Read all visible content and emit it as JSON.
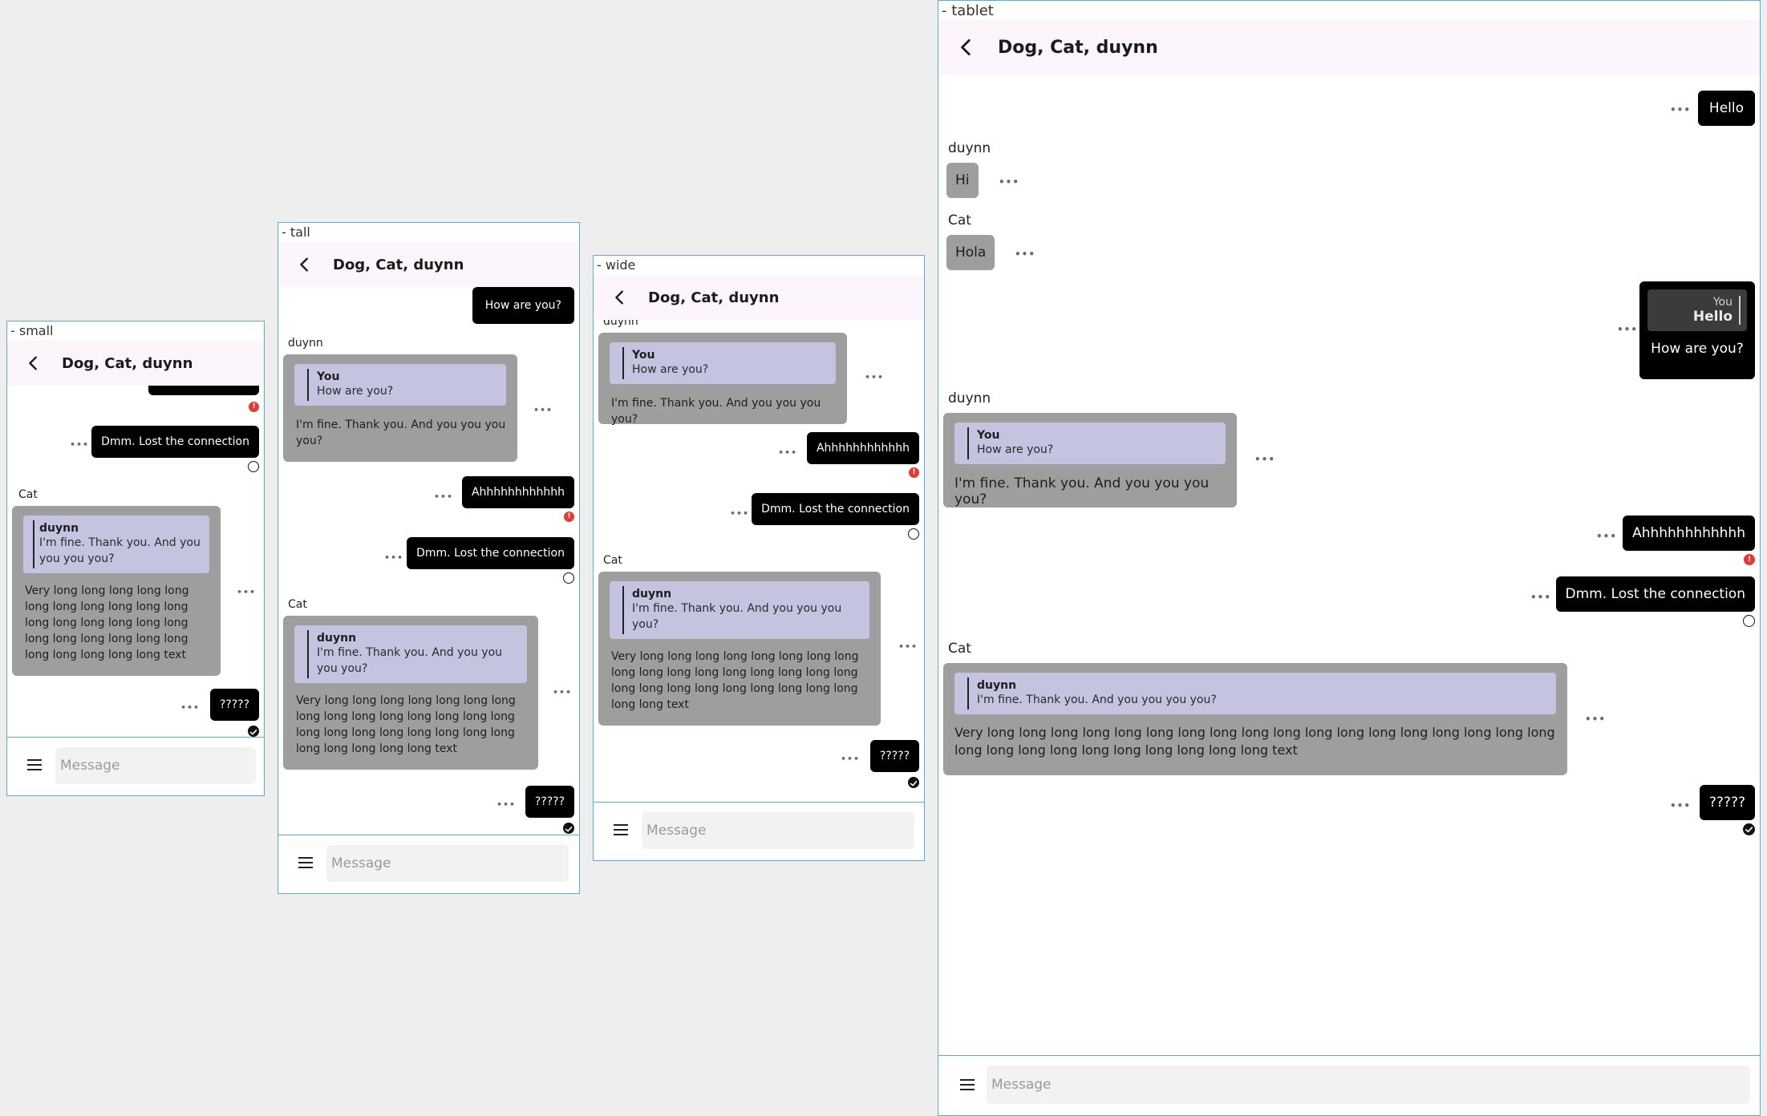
{
  "frames": {
    "small": "- small",
    "tall": "- tall",
    "wide": "- wide",
    "tablet": "- tablet"
  },
  "chat": {
    "title": "Dog, Cat, duynn",
    "input_placeholder": "Message",
    "more": "•••"
  },
  "msgs": {
    "hello": "Hello",
    "hi": "Hi",
    "hola": "Hola",
    "how_are_you": "How are you?",
    "fine": "I'm fine. Thank you. And you you you you?",
    "ahh": "Ahhhhhhhhhhhh",
    "lost": "Dmm. Lost the connection",
    "long": "Very long long long long long long long long long long long long long long long long long long long long long long long long long long long long text",
    "qqq": "?????"
  },
  "senders": {
    "you": "You",
    "duynn": "duynn",
    "cat": "Cat"
  },
  "colors": {
    "frame_border": "#5aaed6",
    "appbar": "#fcf5fc",
    "sent_bubble": "#000000",
    "received_bubble": "#9e9e9e",
    "quote": "#c5c4e0",
    "error": "#e53935"
  },
  "icons": {
    "back": "arrow-back-icon",
    "menu": "menu-icon",
    "error": "error-status-icon",
    "pending": "pending-status-icon",
    "delivered": "delivered-check-icon"
  }
}
